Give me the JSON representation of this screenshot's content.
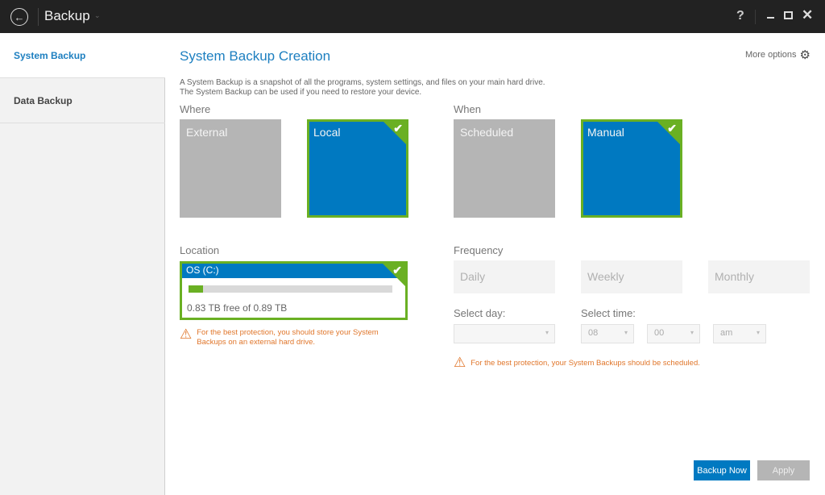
{
  "titlebar": {
    "title": "Backup",
    "back_icon": "arrow-left-circle-icon",
    "back_glyph": "←",
    "chevron_glyph": "⌄",
    "help_glyph": "?",
    "close_glyph": "✕"
  },
  "sidebar": {
    "items": [
      {
        "label": "System Backup",
        "active": true
      },
      {
        "label": "Data Backup",
        "active": false
      }
    ]
  },
  "main": {
    "title": "System Backup Creation",
    "more_options_label": "More options",
    "gear_glyph": "⚙",
    "description_line1": "A System Backup is a snapshot of all the programs, system settings, and files on your main hard drive.",
    "description_line2": "The System Backup can be used if you need to restore your device.",
    "where": {
      "label": "Where",
      "options": [
        {
          "label": "External",
          "selected": false
        },
        {
          "label": "Local",
          "selected": true
        }
      ]
    },
    "when": {
      "label": "When",
      "options": [
        {
          "label": "Scheduled",
          "selected": false
        },
        {
          "label": "Manual",
          "selected": true
        }
      ]
    },
    "check_glyph": "✔",
    "location": {
      "label": "Location",
      "drive_name": "OS (C:)",
      "used_fraction": 0.07,
      "free_text": "0.83 TB free of 0.89 TB",
      "warning_line1": "For the best protection, you should store your System",
      "warning_line2": "Backups on an external hard drive."
    },
    "warning_glyph": "⚠",
    "frequency": {
      "label": "Frequency",
      "options": [
        "Daily",
        "Weekly",
        "Monthly"
      ]
    },
    "select_day": {
      "label": "Select day:",
      "value": ""
    },
    "select_time": {
      "label": "Select time:",
      "hour": "08",
      "minute": "00",
      "period": "am"
    },
    "dropdown_arrow_glyph": "▾",
    "schedule_warning": "For the best protection, your System Backups should be scheduled."
  },
  "actions": {
    "backup_now": "Backup Now",
    "apply": "Apply"
  },
  "colors": {
    "accent_blue": "#0079c1",
    "title_blue": "#1d7fc0",
    "selected_green": "#6ab023",
    "warning_orange": "#e0762b",
    "titlebar_bg": "#222222"
  }
}
